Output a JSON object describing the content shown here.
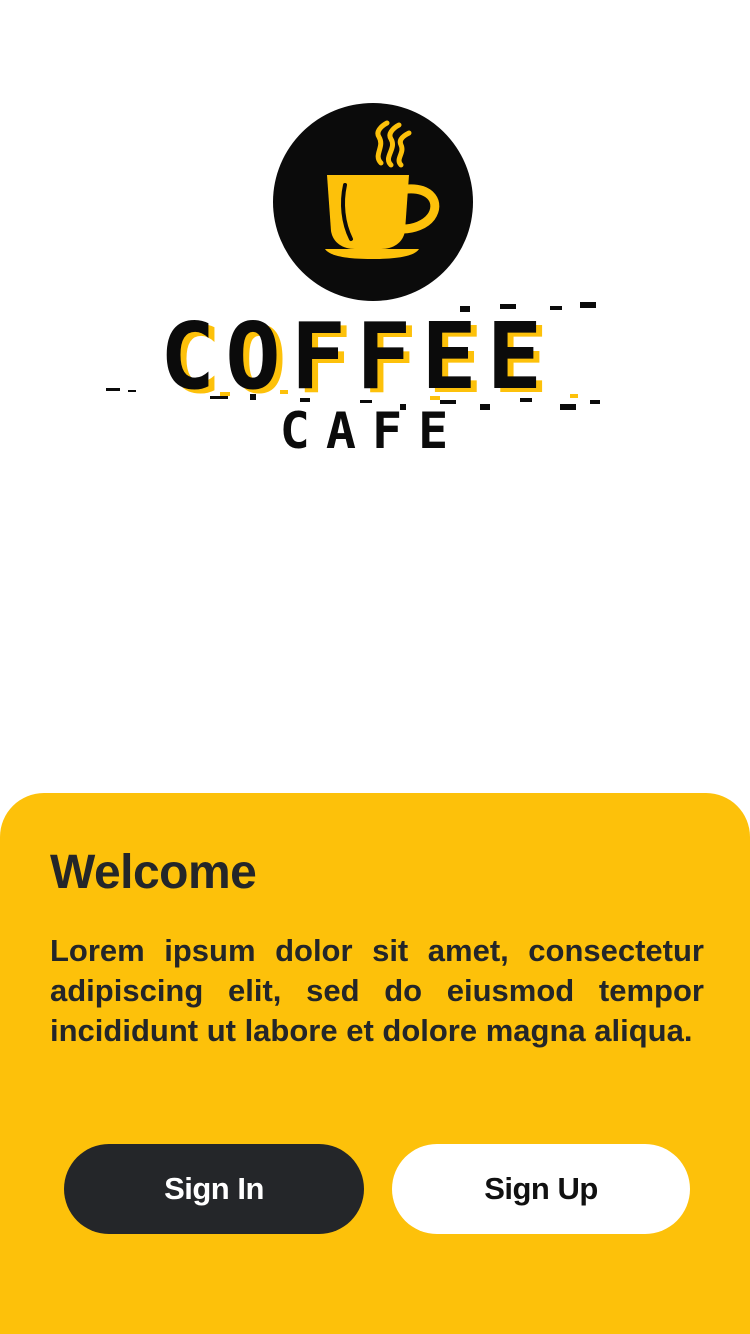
{
  "logo": {
    "line1": "COFFEE",
    "line2": "CAFE",
    "icon": "coffee-cup-icon",
    "colors": {
      "dark": "#0b0b0b",
      "accent": "#fdc10a"
    }
  },
  "welcome": {
    "title": "Welcome",
    "description": "Lorem ipsum dolor sit amet, consectetur adipiscing elit, sed do eiusmod tempor incididunt ut labore et dolore magna aliqua."
  },
  "actions": {
    "sign_in_label": "Sign In",
    "sign_up_label": "Sign Up"
  },
  "colors": {
    "sheet": "#fdc10a",
    "dark_button": "#242629",
    "light_button": "#ffffff"
  }
}
